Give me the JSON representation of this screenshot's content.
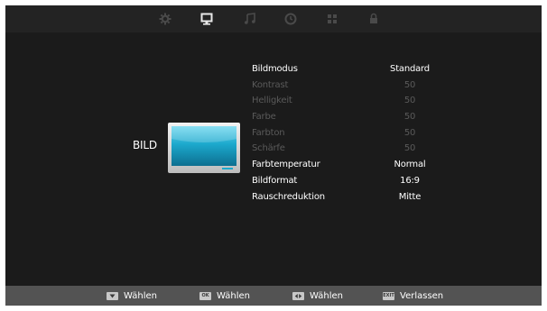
{
  "menu": {
    "tabs": [
      {
        "icon": "gear-icon",
        "active": false
      },
      {
        "icon": "monitor-icon",
        "active": true
      },
      {
        "icon": "music-note-icon",
        "active": false
      },
      {
        "icon": "clock-icon",
        "active": false
      },
      {
        "icon": "grid-icon",
        "active": false
      },
      {
        "icon": "lock-icon",
        "active": false
      }
    ]
  },
  "section": {
    "title": "BILD",
    "icon": "tv-icon"
  },
  "settings": [
    {
      "label": "Bildmodus",
      "value": "Standard",
      "enabled": true
    },
    {
      "label": "Kontrast",
      "value": "50",
      "enabled": false
    },
    {
      "label": "Helligkeit",
      "value": "50",
      "enabled": false
    },
    {
      "label": "Farbe",
      "value": "50",
      "enabled": false
    },
    {
      "label": "Farbton",
      "value": "50",
      "enabled": false
    },
    {
      "label": "Schärfe",
      "value": "50",
      "enabled": false
    },
    {
      "label": "Farbtemperatur",
      "value": "Normal",
      "enabled": true
    },
    {
      "label": "Bildformat",
      "value": "16:9",
      "enabled": true
    },
    {
      "label": "Rauschreduktion",
      "value": "Mitte",
      "enabled": true
    }
  ],
  "footer": {
    "hints": [
      {
        "key": "down-arrow-key-icon",
        "label": "Wählen"
      },
      {
        "key_text": "OK",
        "label": "Wählen"
      },
      {
        "key": "left-right-key-icon",
        "label": "Wählen"
      },
      {
        "key_text": "EXIT",
        "label": "Verlassen"
      }
    ]
  },
  "colors": {
    "background": "#1b1b1b",
    "active_text": "#ffffff",
    "inactive_text": "#5a5a5a",
    "footer_bg": "#535353",
    "tv_screen": "#1aa6c8"
  }
}
